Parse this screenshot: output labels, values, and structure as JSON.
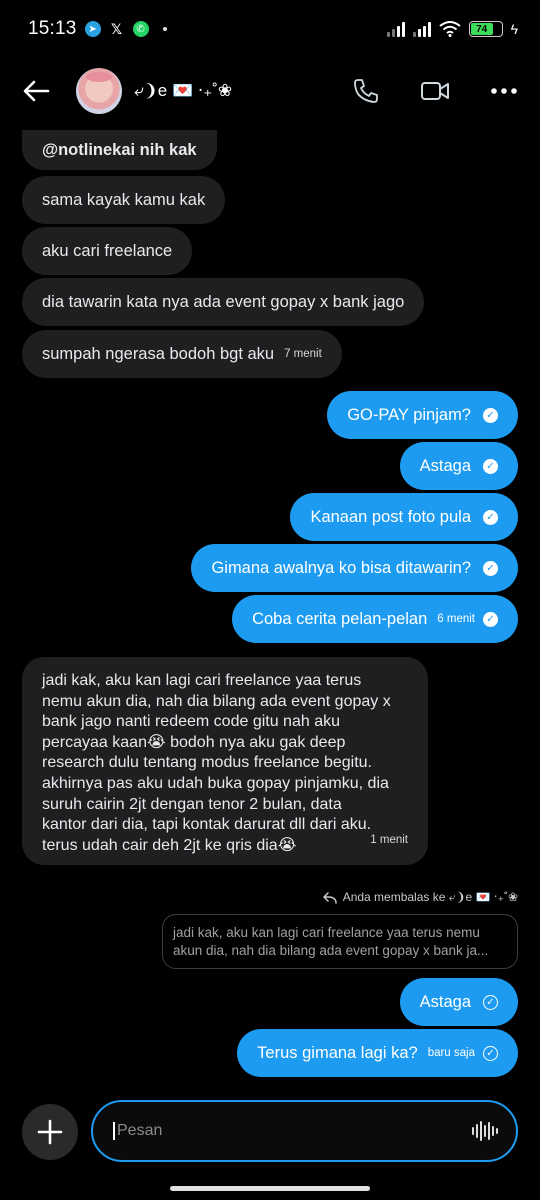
{
  "status_bar": {
    "time": "15:13",
    "battery": "74"
  },
  "header": {
    "contact_name": "⤶❩e 💌 ‧₊˚❀"
  },
  "messages_in_top": [
    {
      "text": "@notlinekai nih kak"
    },
    {
      "text": "sama kayak kamu kak"
    },
    {
      "text": "aku cari freelance"
    },
    {
      "text": "dia tawarin kata nya ada event gopay x bank jago"
    },
    {
      "text": "sumpah ngerasa bodoh bgt aku",
      "time": "7 menit"
    }
  ],
  "messages_out": [
    {
      "text": "GO-PAY pinjam?"
    },
    {
      "text": "Astaga"
    },
    {
      "text": "Kanaan post foto pula"
    },
    {
      "text": "Gimana awalnya ko bisa ditawarin?"
    },
    {
      "text": "Coba cerita pelan-pelan",
      "time": "6 menit"
    }
  ],
  "long_message": {
    "text": "jadi kak, aku kan lagi cari freelance yaa terus\nnemu akun dia, nah dia bilang ada event gopay x\nbank jago nanti redeem code gitu nah aku\npercayaa kaan😭 bodoh nya aku gak deep\nresearch dulu tentang modus freelance begitu.\nakhirnya pas aku udah buka gopay pinjamku, dia\nsuruh cairin 2jt dengan tenor 2 bulan, data\nkantor dari dia, tapi kontak darurat dll dari aku.\nterus udah cair deh 2jt ke qris dia😭",
    "time": "1 menit"
  },
  "reply": {
    "label": "Anda membalas ke ⤶❩e 💌 ‧₊˚❀",
    "quote": "jadi kak, aku kan lagi cari freelance yaa terus nemu\nakun dia, nah dia bilang ada event gopay x bank ja..."
  },
  "recent_out": [
    {
      "text": "Astaga"
    },
    {
      "text": "Terus gimana lagi ka?",
      "time": "baru saja"
    }
  ],
  "composer": {
    "placeholder": "Pesan"
  },
  "colors": {
    "accent": "#1d9bf0",
    "incoming_bubble": "#1f1f22",
    "background": "#000000"
  }
}
